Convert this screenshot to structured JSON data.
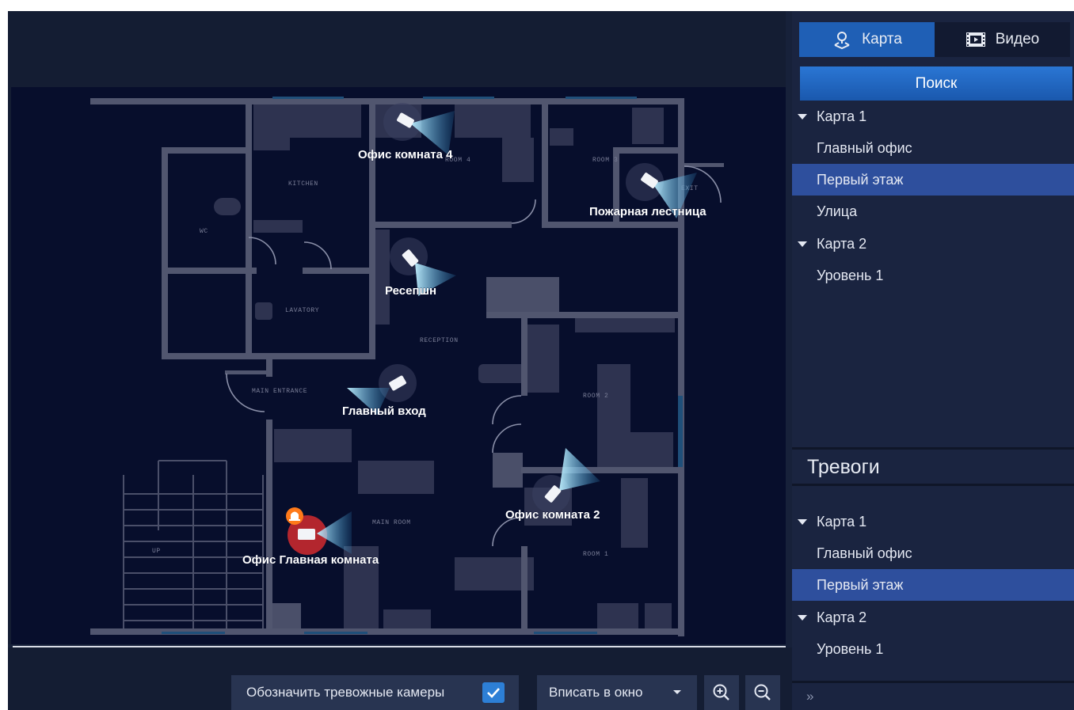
{
  "map": {
    "room_labels": {
      "kitchen": "KITCHEN",
      "wc": "WC",
      "lavatory": "LAVATORY",
      "reception": "RECEPTION",
      "main_entrance": "MAIN ENTRANCE",
      "main_room": "MAIN ROOM",
      "up": "UP",
      "room4": "ROOM 4",
      "room3": "ROOM 3",
      "exit": "EXIT",
      "room2": "ROOM 2",
      "room1": "ROOM 1"
    },
    "cameras": [
      {
        "label": "Офис комната 4",
        "alarm": false
      },
      {
        "label": "Пожарная лестница",
        "alarm": false
      },
      {
        "label": "Ресепшн",
        "alarm": false
      },
      {
        "label": "Главный вход",
        "alarm": false
      },
      {
        "label": "Офис комната 2",
        "alarm": false
      },
      {
        "label": "Офис Главная комната",
        "alarm": true
      }
    ]
  },
  "toolbar": {
    "mark_alarm_label": "Обозначить тревожные камеры",
    "mark_alarm_checked": true,
    "fit_label": "Вписать в окно"
  },
  "panel": {
    "tabs": {
      "map": "Карта",
      "video": "Видео",
      "active": "map"
    },
    "search_label": "Поиск",
    "maps_tree": [
      {
        "label": "Карта 1",
        "level": 0,
        "expanded": true
      },
      {
        "label": "Главный офис",
        "level": 1
      },
      {
        "label": "Первый этаж",
        "level": 1,
        "selected": true
      },
      {
        "label": "Улица",
        "level": 1
      },
      {
        "label": "Карта 2",
        "level": 0,
        "expanded": true
      },
      {
        "label": "Уровень 1",
        "level": 1
      }
    ],
    "alarms_title": "Тревоги",
    "alarms_tree": [
      {
        "label": "Карта 1",
        "level": 0,
        "expanded": true
      },
      {
        "label": "Главный офис",
        "level": 1
      },
      {
        "label": "Первый этаж",
        "level": 1,
        "selected": true
      },
      {
        "label": "Карта 2",
        "level": 0,
        "expanded": true
      },
      {
        "label": "Уровень 1",
        "level": 1
      }
    ],
    "expand_glyph": "»"
  },
  "colors": {
    "accent": "#2d7fd6",
    "selected_row": "#2e4f9d",
    "alarm": "#ff7a1a",
    "alarm_halo": "#b3262e",
    "wall": "#51566f",
    "floor": "#070e2c"
  }
}
